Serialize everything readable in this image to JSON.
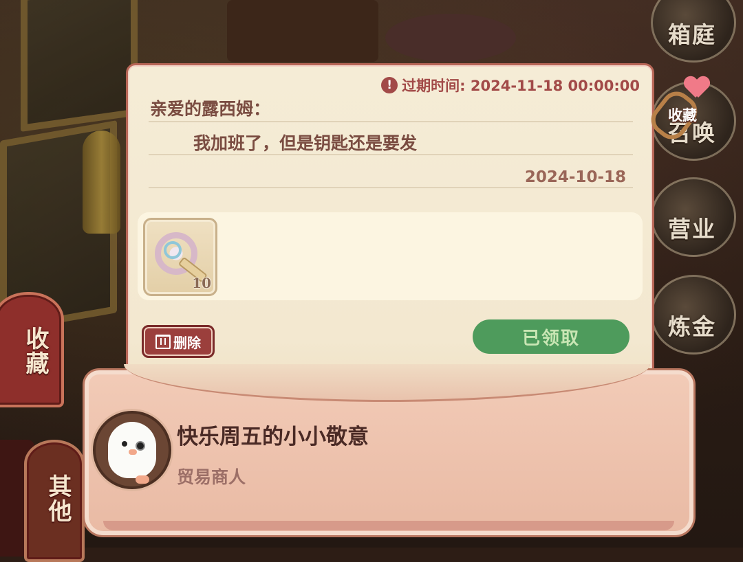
{
  "right_menu": [
    {
      "label": "箱庭",
      "icon": "sprout-icon"
    },
    {
      "label": "召唤",
      "icon": "summon-icon"
    },
    {
      "label": "营业",
      "icon": "shop-icon"
    },
    {
      "label": "炼金",
      "icon": "cauldron-icon"
    }
  ],
  "left_tabs": {
    "collection": "收藏",
    "other": "其他"
  },
  "collect_badge": {
    "label": "收藏"
  },
  "letter": {
    "expire_icon": "!",
    "expire_text": "过期时间: 2024-11-18 00:00:00",
    "greeting": "亲爱的露西姆：",
    "body": "我加班了，但是钥匙还是要发",
    "date": "2024-10-18",
    "reward": {
      "icon": "rainbow-key-icon",
      "quantity": "10"
    },
    "delete_label": "删除",
    "claimed_label": "已领取"
  },
  "sender": {
    "title": "快乐周五的小小敬意",
    "name": "贸易商人",
    "avatar": "white-bird-avatar"
  },
  "colors": {
    "claimed_button": "#4e9b5c",
    "delete_button": "#9b3f3c",
    "envelope": "#f2cbb7",
    "expire_text": "#a24a48"
  }
}
